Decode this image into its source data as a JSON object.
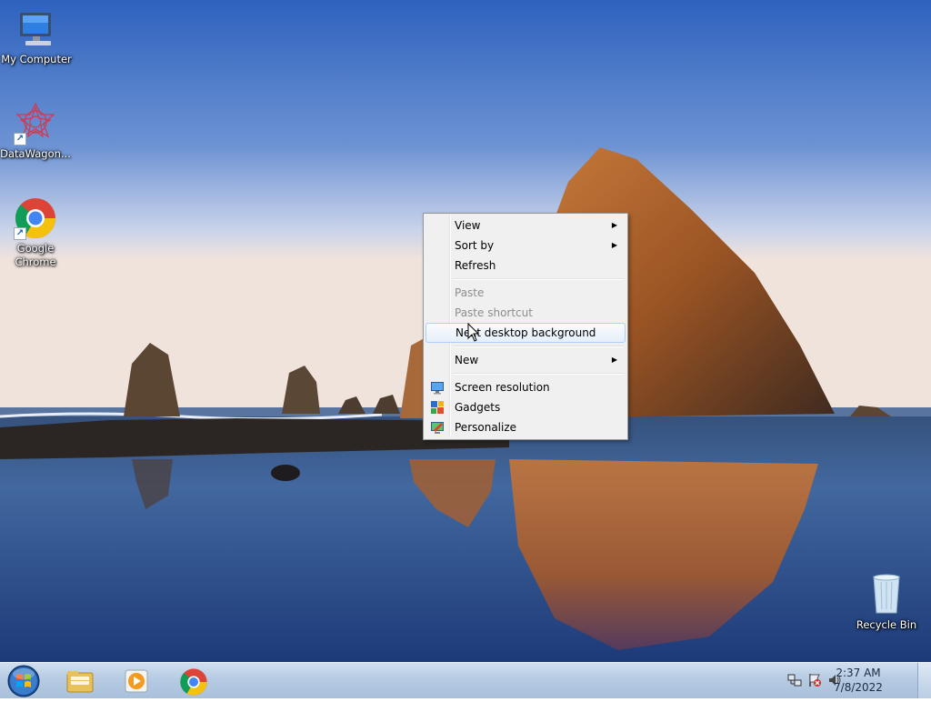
{
  "desktop_icons": [
    {
      "label": "My Computer"
    },
    {
      "label": "DataWagon..."
    },
    {
      "label": "Google Chrome"
    },
    {
      "label": "Recycle Bin"
    }
  ],
  "context_menu": {
    "view": "View",
    "sort_by": "Sort by",
    "refresh": "Refresh",
    "paste": "Paste",
    "paste_shortcut": "Paste shortcut",
    "next_background": "Next desktop background",
    "new": "New",
    "screen_resolution": "Screen resolution",
    "gadgets": "Gadgets",
    "personalize": "Personalize"
  },
  "taskbar": {
    "pinned": [
      "start-orb",
      "file-explorer-icon",
      "media-player-icon",
      "chrome-icon"
    ],
    "clock_time": "2:37 AM",
    "clock_date": "7/8/2022"
  },
  "colors": {
    "menu_bg": "#f0f0f0",
    "menu_hover_border": "#aecff7",
    "taskbar_top": "#cfdff0",
    "sky_top": "#2f63c0"
  }
}
